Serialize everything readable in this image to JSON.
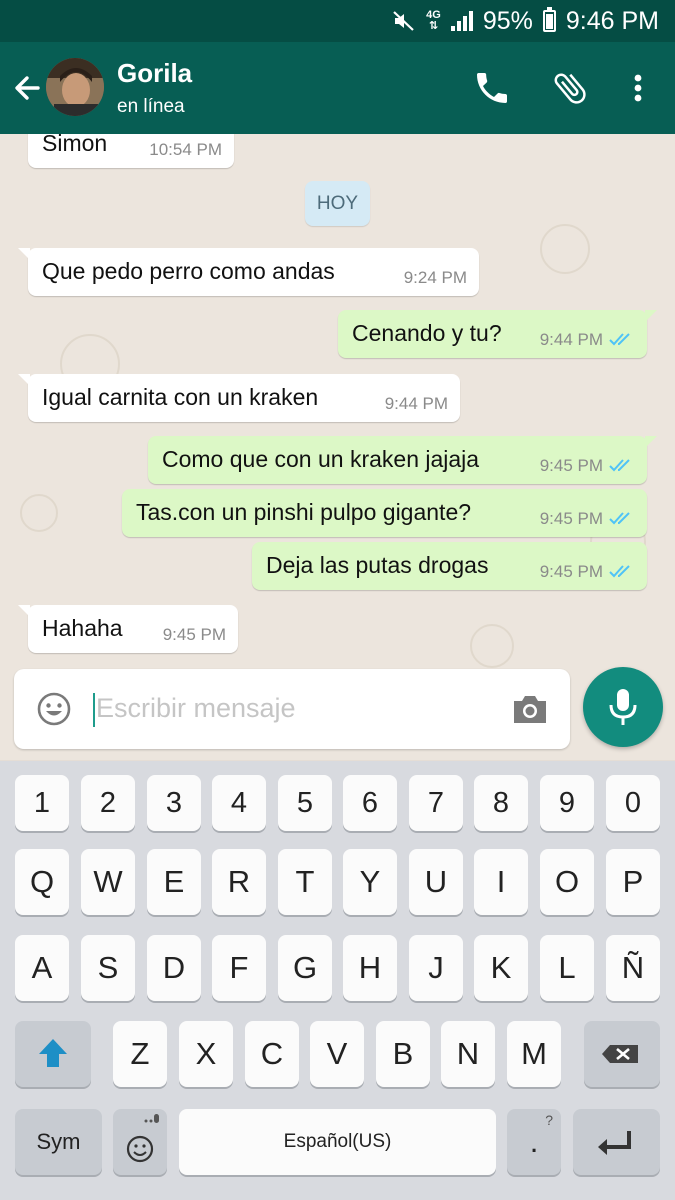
{
  "status_bar": {
    "network": "4G",
    "battery": "95%",
    "time": "9:46 PM"
  },
  "header": {
    "contact_name": "Gorila",
    "contact_status": "en línea"
  },
  "chat": {
    "partial_message": {
      "text": "Simon",
      "time": "10:54 PM"
    },
    "date_label": "HOY",
    "messages": [
      {
        "direction": "in",
        "text": "Que pedo perro como andas",
        "time": "9:24 PM"
      },
      {
        "direction": "out",
        "text": "Cenando y tu?",
        "time": "9:44 PM",
        "read": true
      },
      {
        "direction": "in",
        "text": "Igual carnita con un kraken",
        "time": "9:44 PM"
      },
      {
        "direction": "out",
        "text": "Como que con un kraken jajaja",
        "time": "9:45 PM",
        "read": true
      },
      {
        "direction": "out",
        "text": "Tas.con un pinshi pulpo gigante?",
        "time": "9:45 PM",
        "read": true
      },
      {
        "direction": "out",
        "text": "Deja las putas drogas",
        "time": "9:45 PM",
        "read": true
      },
      {
        "direction": "in",
        "text": "Hahaha",
        "time": "9:45 PM"
      }
    ]
  },
  "composer": {
    "placeholder": "Escribir mensaje"
  },
  "keyboard": {
    "number_row": [
      "1",
      "2",
      "3",
      "4",
      "5",
      "6",
      "7",
      "8",
      "9",
      "0"
    ],
    "row1": [
      "Q",
      "W",
      "E",
      "R",
      "T",
      "Y",
      "U",
      "I",
      "O",
      "P"
    ],
    "row2": [
      "A",
      "S",
      "D",
      "F",
      "G",
      "H",
      "J",
      "K",
      "L",
      "Ñ"
    ],
    "row3": [
      "Z",
      "X",
      "C",
      "V",
      "B",
      "N",
      "M"
    ],
    "sym_label": "Sym",
    "space_label": "Español(US)",
    "period_label": ".",
    "period_hint": "?"
  },
  "colors": {
    "header": "#075e54",
    "status_bar": "#054d44",
    "outgoing_bubble": "#dcf8c6",
    "incoming_bubble": "#ffffff",
    "accent": "#128c7e",
    "read_ticks": "#4fc3f7",
    "shift_arrow": "#1e8fc6"
  }
}
